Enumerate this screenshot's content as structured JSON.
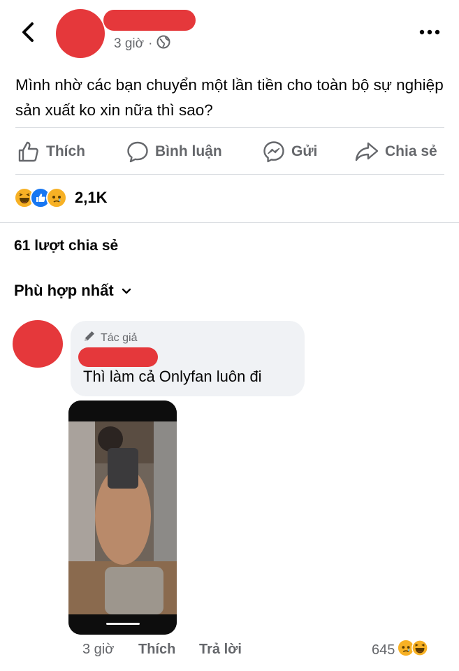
{
  "post": {
    "time": "3 giờ",
    "separator": "·",
    "text": "Mình nhờ các bạn chuyển một lần tiền cho toàn bộ sự nghiệp sản xuất ko xin nữa thì sao?",
    "actions": [
      {
        "label": "Thích",
        "icon": "thumbs-up-icon"
      },
      {
        "label": "Bình luận",
        "icon": "comment-icon"
      },
      {
        "label": "Gửi",
        "icon": "messenger-icon"
      },
      {
        "label": "Chia sẻ",
        "icon": "share-icon"
      }
    ],
    "reactions": {
      "icons": [
        "haha-reaction-icon",
        "like-reaction-icon",
        "sad-reaction-icon"
      ],
      "count": "2,1K"
    },
    "shares": "61 lượt chia sẻ"
  },
  "comments": {
    "sort_label": "Phù hợp nhất"
  },
  "comment": {
    "author_badge": "Tác giả",
    "text": "Thì làm cả Onlyfan luôn đi",
    "time": "3 giờ",
    "like_label": "Thích",
    "reply_label": "Trả lời",
    "reaction_count": "645",
    "reaction_icons": [
      "sad-reaction-icon",
      "haha-reaction-icon"
    ]
  },
  "colors": {
    "redaction": "#e5383b",
    "secondary_text": "#65676b",
    "bubble": "#f0f2f5",
    "like_blue": "#1877f2",
    "emoji_yellow": "#f7b125"
  }
}
